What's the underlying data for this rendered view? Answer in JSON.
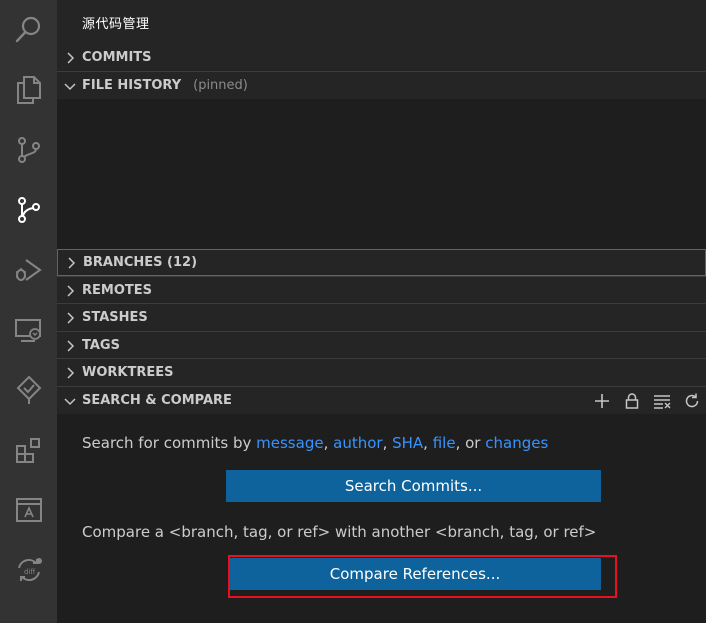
{
  "sidebar": {
    "title": "源代码管理"
  },
  "sections": {
    "commits": "COMMITS",
    "file_history": "FILE HISTORY",
    "file_history_badge": "(pinned)",
    "branches": "BRANCHES (12)",
    "remotes": "REMOTES",
    "stashes": "STASHES",
    "tags": "TAGS",
    "worktrees": "WORKTREES",
    "search_compare": "SEARCH & COMPARE"
  },
  "search": {
    "prefix": "Search for commits by",
    "message": "message",
    "author": "author",
    "sha": "SHA",
    "file": "file",
    "or": "or",
    "changes": "changes",
    "button": "Search Commits..."
  },
  "compare": {
    "text": "Compare a <branch, tag, or ref> with another <branch, tag, or ref>",
    "button": "Compare References..."
  },
  "colors": {
    "accent": "#0e639c",
    "link": "#3794ff",
    "highlight": "#e81123",
    "focus": "#007fd4"
  },
  "icons": [
    "search-icon",
    "explorer-icon",
    "source-control-icon",
    "gitlens-icon",
    "run-debug-icon",
    "remote-explorer-icon",
    "gitlens-inspect-icon",
    "extensions-icon",
    "preview-icon",
    "sync-diff-icon"
  ]
}
